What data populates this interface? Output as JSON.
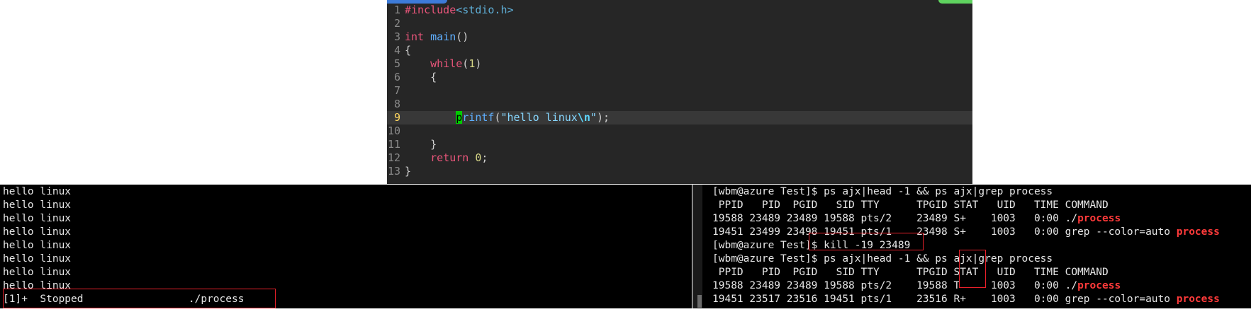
{
  "editor": {
    "lines": [
      {
        "num": "1",
        "parts": [
          {
            "t": "#include",
            "c": "kw"
          },
          {
            "t": "<stdio.h>",
            "c": "pp"
          }
        ]
      },
      {
        "num": "2",
        "parts": []
      },
      {
        "num": "3",
        "parts": [
          {
            "t": "int",
            "c": "kw"
          },
          {
            "t": " "
          },
          {
            "t": "main",
            "c": "fn"
          },
          {
            "t": "()"
          }
        ]
      },
      {
        "num": "4",
        "parts": [
          {
            "t": "{"
          }
        ]
      },
      {
        "num": "5",
        "parts": [
          {
            "t": "    "
          },
          {
            "t": "while",
            "c": "kw"
          },
          {
            "t": "("
          },
          {
            "t": "1",
            "c": "num"
          },
          {
            "t": ")"
          }
        ]
      },
      {
        "num": "6",
        "parts": [
          {
            "t": "    {"
          }
        ]
      },
      {
        "num": "7",
        "parts": []
      },
      {
        "num": "8",
        "parts": []
      },
      {
        "num": "9",
        "current": true,
        "parts": [
          {
            "t": "        "
          },
          {
            "t": "p",
            "c": "cursor"
          },
          {
            "t": "rintf",
            "c": "fn"
          },
          {
            "t": "("
          },
          {
            "t": "\"hello linux",
            "c": "str"
          },
          {
            "t": "\\n",
            "c": "esc"
          },
          {
            "t": "\"",
            "c": "str"
          },
          {
            "t": ");"
          }
        ]
      },
      {
        "num": "10",
        "parts": []
      },
      {
        "num": "11",
        "parts": [
          {
            "t": "    }"
          }
        ]
      },
      {
        "num": "12",
        "parts": [
          {
            "t": "    "
          },
          {
            "t": "return",
            "c": "kw"
          },
          {
            "t": " "
          },
          {
            "t": "0",
            "c": "num"
          },
          {
            "t": ";"
          }
        ]
      },
      {
        "num": "13",
        "parts": [
          {
            "t": "}"
          }
        ]
      }
    ]
  },
  "left_terminal": {
    "lines": [
      "hello linux",
      "hello linux",
      "hello linux",
      "hello linux",
      "hello linux",
      "hello linux",
      "hello linux",
      "hello linux",
      "[1]+  Stopped                 ./process"
    ]
  },
  "right_terminal": {
    "lines": [
      [
        {
          "t": "[wbm@azure Test]$ ps ajx|head -1 && ps ajx|grep process"
        }
      ],
      [
        {
          "t": " PPID   PID  PGID   SID TTY      TPGID STAT   UID   TIME COMMAND"
        }
      ],
      [
        {
          "t": "19588 23489 23489 19588 pts/2    23489 S+    1003   0:00 ./"
        },
        {
          "t": "process",
          "hl": true
        }
      ],
      [
        {
          "t": "19451 23499 23498 19451 pts/1    23498 S+    1003   0:00 grep --color=auto "
        },
        {
          "t": "process",
          "hl": true
        }
      ],
      [
        {
          "t": "[wbm@azure Test]$ kill -19 23489"
        }
      ],
      [
        {
          "t": "[wbm@azure Test]$ ps ajx|head -1 && ps ajx|grep process"
        }
      ],
      [
        {
          "t": " PPID   PID  PGID   SID TTY      TPGID STAT   UID   TIME COMMAND"
        }
      ],
      [
        {
          "t": "19588 23489 23489 19588 pts/2    19588 T     1003   0:00 ./"
        },
        {
          "t": "process",
          "hl": true
        }
      ],
      [
        {
          "t": "19451 23517 23516 19451 pts/1    23516 R+    1003   0:00 grep --color=auto "
        },
        {
          "t": "process",
          "hl": true
        }
      ]
    ]
  }
}
